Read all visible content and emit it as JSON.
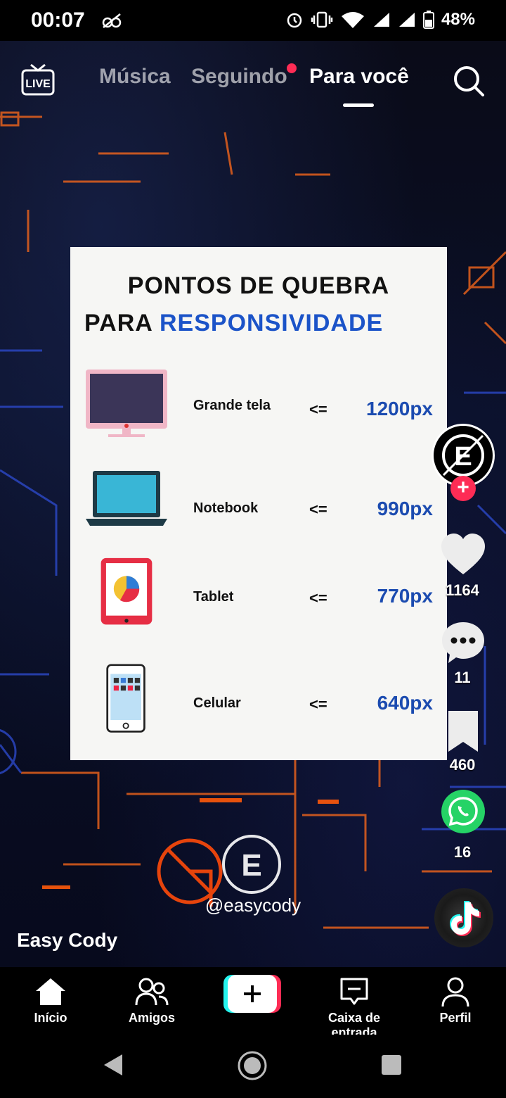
{
  "status": {
    "time": "00:07",
    "battery": "48%"
  },
  "topnav": {
    "tabs": [
      "Música",
      "Seguindo",
      "Para você"
    ]
  },
  "card": {
    "title_line1": "PONTOS DE QUEBRA",
    "title_line2_prefix": "PARA ",
    "title_line2_highlight": "RESPONSIVIDADE",
    "rows": [
      {
        "label": "Grande tela",
        "op": "<=",
        "value": "1200px",
        "icon": "desktop-monitor-icon"
      },
      {
        "label": "Notebook",
        "op": "<=",
        "value": "990px",
        "icon": "laptop-icon"
      },
      {
        "label": "Tablet",
        "op": "<=",
        "value": "770px",
        "icon": "tablet-icon"
      },
      {
        "label": "Celular",
        "op": "<=",
        "value": "640px",
        "icon": "smartphone-icon"
      }
    ]
  },
  "overlay": {
    "watermark": "@easycody",
    "username": "Easy Cody"
  },
  "rail": {
    "likes": "1164",
    "comments": "11",
    "saves": "460",
    "shares": "16"
  },
  "bottomnav": {
    "items": [
      "Início",
      "Amigos",
      "Caixa de entrada",
      "Perfil"
    ]
  },
  "colors": {
    "accent": "#fe2c55",
    "highlight_blue": "#1b53c8"
  }
}
